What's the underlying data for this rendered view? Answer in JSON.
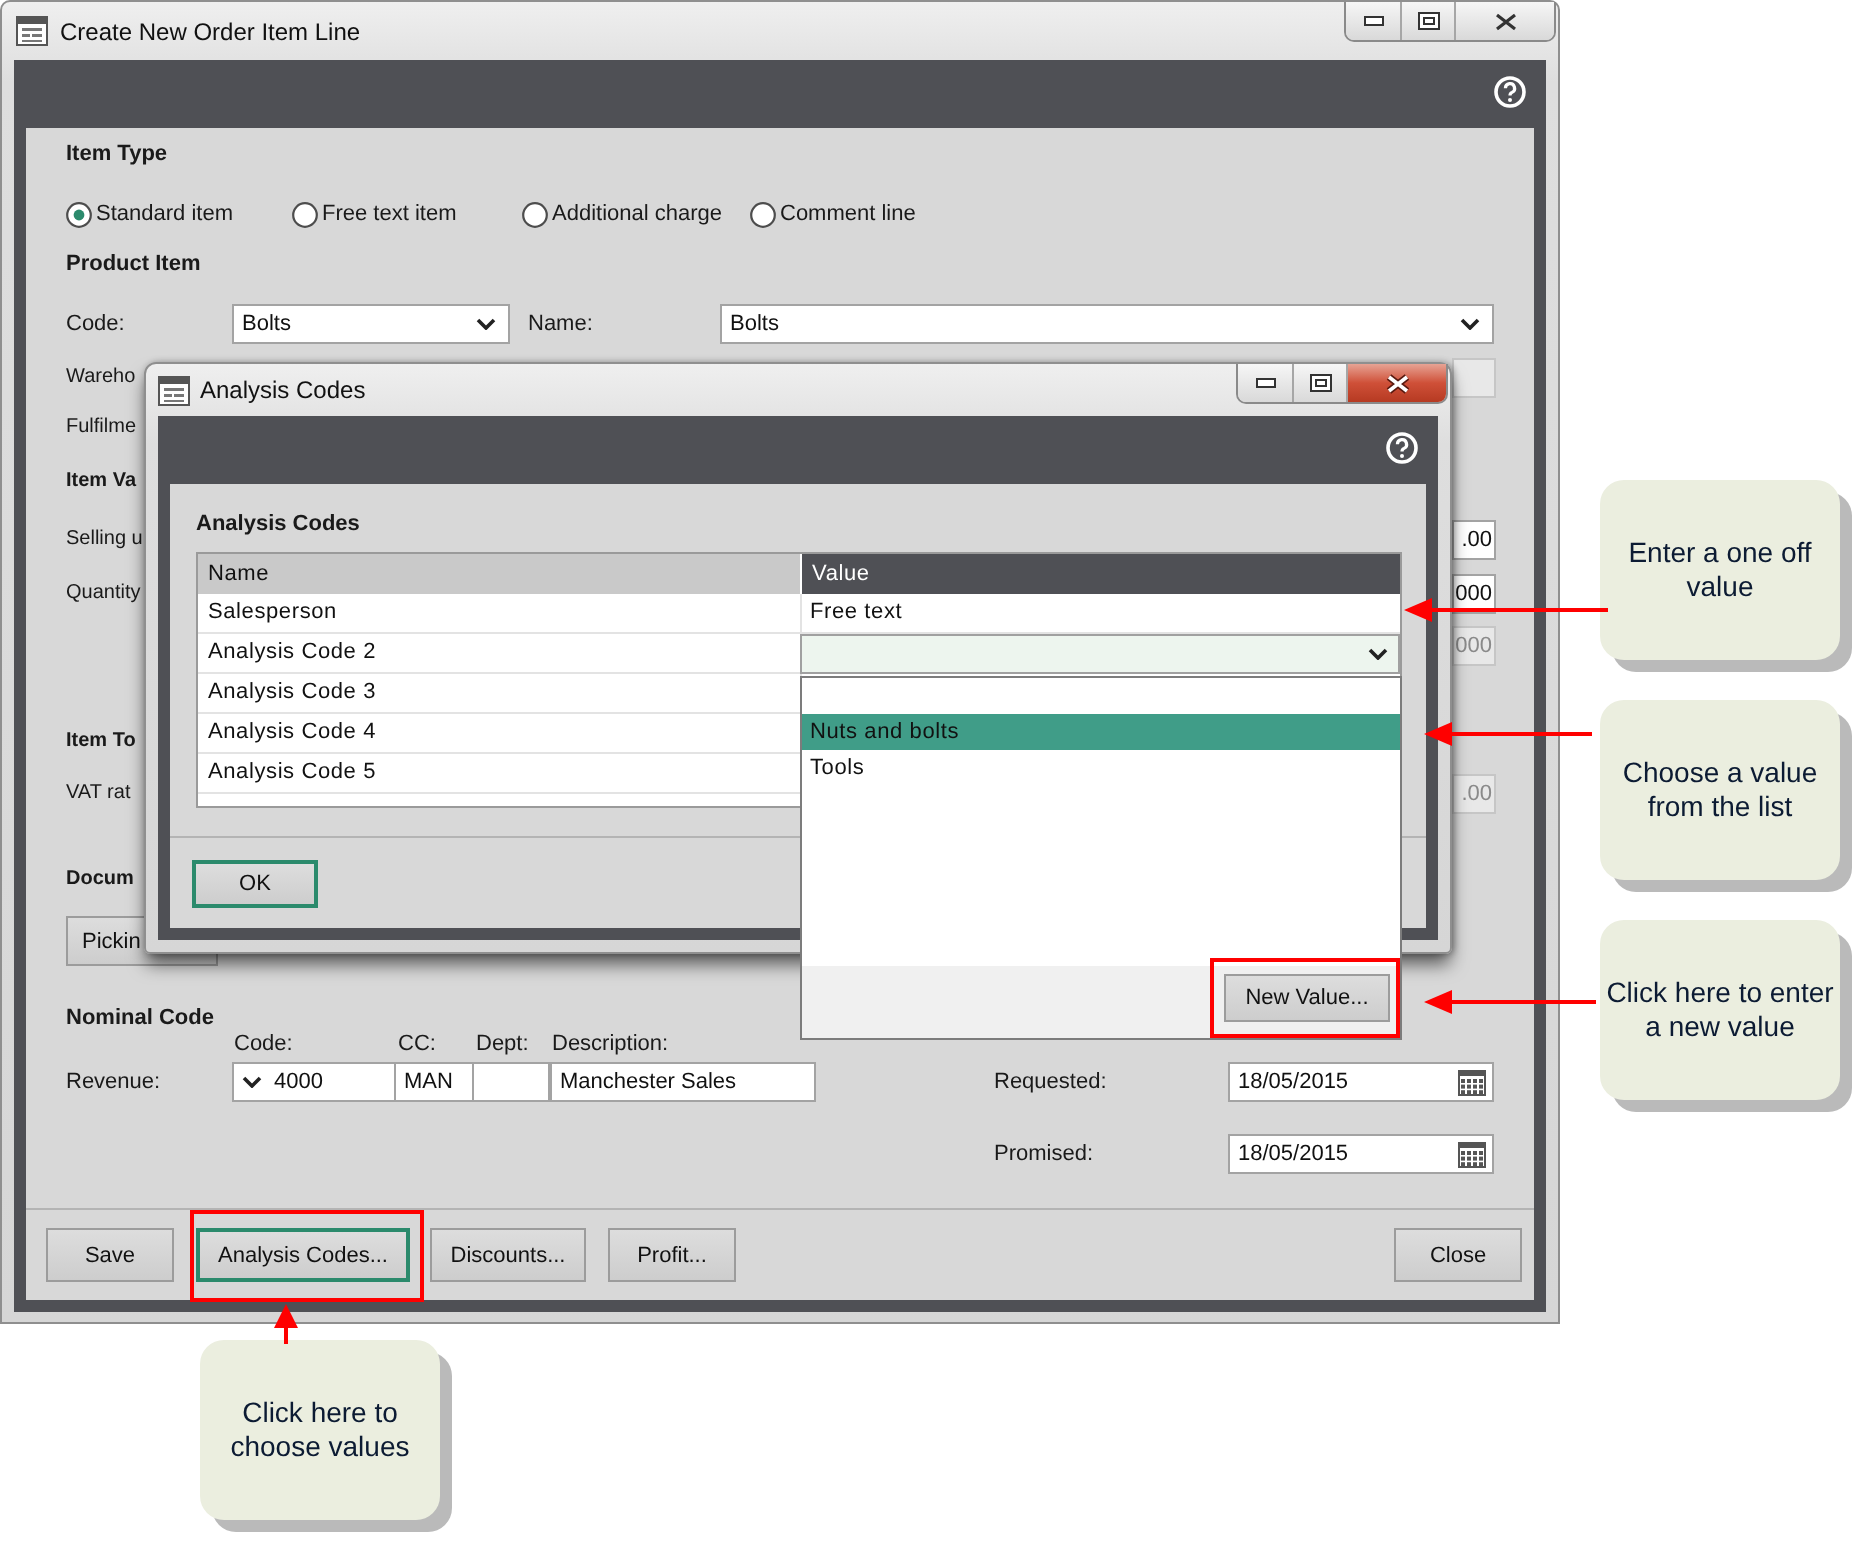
{
  "main_window": {
    "title": "Create New Order Item Line",
    "active": false,
    "item_type": {
      "heading": "Item Type",
      "options": [
        {
          "label": "Standard item",
          "selected": true
        },
        {
          "label": "Free text item",
          "selected": false
        },
        {
          "label": "Additional charge",
          "selected": false
        },
        {
          "label": "Comment line",
          "selected": false
        }
      ]
    },
    "product_item": {
      "heading": "Product Item",
      "code": {
        "label": "Code:",
        "value": "Bolts"
      },
      "name": {
        "label": "Name:",
        "value": "Bolts"
      }
    },
    "partly_covered_rows": [
      {
        "kind": "label",
        "text": "Wareho",
        "field": {
          "disabled": true
        }
      },
      {
        "kind": "label",
        "text": "Fulfilme"
      },
      {
        "kind": "heading",
        "text": "Item Va"
      },
      {
        "kind": "label",
        "text": "Selling u",
        "field": {
          "value": ".00",
          "disabled": false
        }
      },
      {
        "kind": "label",
        "text": "Quantity",
        "field": {
          "value": "000",
          "disabled": false
        }
      },
      {
        "kind": "blank",
        "field": {
          "value": "000",
          "disabled": true
        }
      },
      {
        "kind": "heading",
        "text": "Item To"
      },
      {
        "kind": "label",
        "text": "VAT rat",
        "field": {
          "value": ".00",
          "disabled": true
        }
      },
      {
        "kind": "heading",
        "text": "Docum"
      },
      {
        "kind": "button",
        "text": "Pickin"
      }
    ],
    "nominal_code": {
      "heading": "Nominal Code",
      "columns": [
        "Code:",
        "CC:",
        "Dept:",
        "Description:"
      ],
      "label": "Revenue:",
      "code": "4000",
      "cc": "MAN",
      "description": "Manchester Sales"
    },
    "dates": [
      {
        "label": "Requested:",
        "value": "18/05/2015"
      },
      {
        "label": "Promised:",
        "value": "18/05/2015"
      }
    ],
    "buttons": [
      {
        "label": "Save",
        "focused": false
      },
      {
        "label": "Analysis Codes...",
        "focused": true
      },
      {
        "label": "Discounts...",
        "focused": false
      },
      {
        "label": "Profit...",
        "focused": false
      }
    ],
    "close_button": {
      "label": "Close",
      "focused": false
    }
  },
  "dialog": {
    "title": "Analysis Codes",
    "active": true,
    "heading": "Analysis Codes",
    "columns": [
      "Name",
      "Value"
    ],
    "rows": [
      {
        "name": "Salesperson",
        "kind": "text",
        "value": "Free text"
      },
      {
        "name": "Analysis Code 2",
        "kind": "dropdown"
      },
      {
        "name": "Analysis Code 3",
        "kind": "covered"
      },
      {
        "name": "Analysis Code 4",
        "kind": "covered"
      },
      {
        "name": "Analysis Code 5",
        "kind": "covered"
      }
    ],
    "dropdown_list": {
      "options": [
        {
          "label": "Nuts and bolts",
          "selected": true
        },
        {
          "label": "Tools",
          "selected": false
        }
      ],
      "new_value_button": "New Value..."
    },
    "ok_button": {
      "label": "OK",
      "focused": true
    }
  },
  "callouts": [
    {
      "text": "Enter a one off value"
    },
    {
      "text": "Choose a value from the list"
    },
    {
      "text": "Click here to enter a new value"
    },
    {
      "text": "Click here to choose values"
    }
  ]
}
